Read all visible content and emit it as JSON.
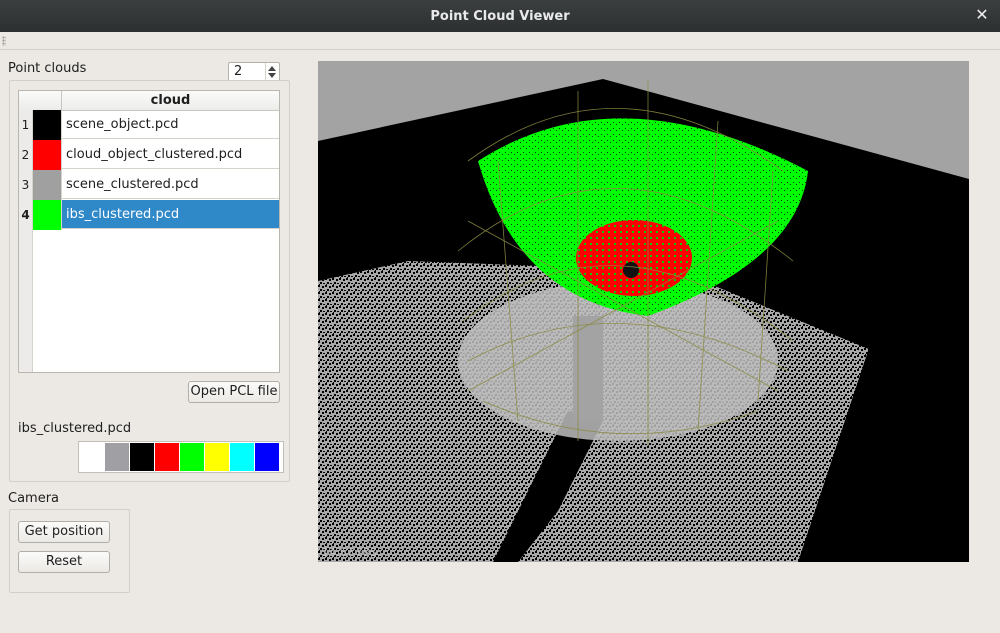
{
  "window": {
    "title": "Point Cloud Viewer",
    "close_glyph": "✕"
  },
  "point_clouds": {
    "label": "Point clouds",
    "spin_value": "2",
    "table": {
      "column_header": "cloud",
      "rows": [
        {
          "num": "1",
          "color": "#000000",
          "name": "scene_object.pcd"
        },
        {
          "num": "2",
          "color": "#ff0000",
          "name": "cloud_object_clustered.pcd"
        },
        {
          "num": "3",
          "color": "#a0a0a0",
          "name": "scene_clustered.pcd"
        },
        {
          "num": "4",
          "color": "#00ff00",
          "name": "ibs_clustered.pcd",
          "selected": true
        }
      ]
    },
    "open_button": "Open PCL file",
    "selected_file": "ibs_clustered.pcd",
    "palette": [
      "#ffffff",
      "#a0a0a4",
      "#000000",
      "#ff0000",
      "#00ff00",
      "#ffff00",
      "#00ffff",
      "#0000ff"
    ]
  },
  "camera": {
    "label": "Camera",
    "get_position_button": "Get position",
    "reset_button": "Reset"
  },
  "viewport": {
    "fps_text": "14.57 FPS"
  }
}
